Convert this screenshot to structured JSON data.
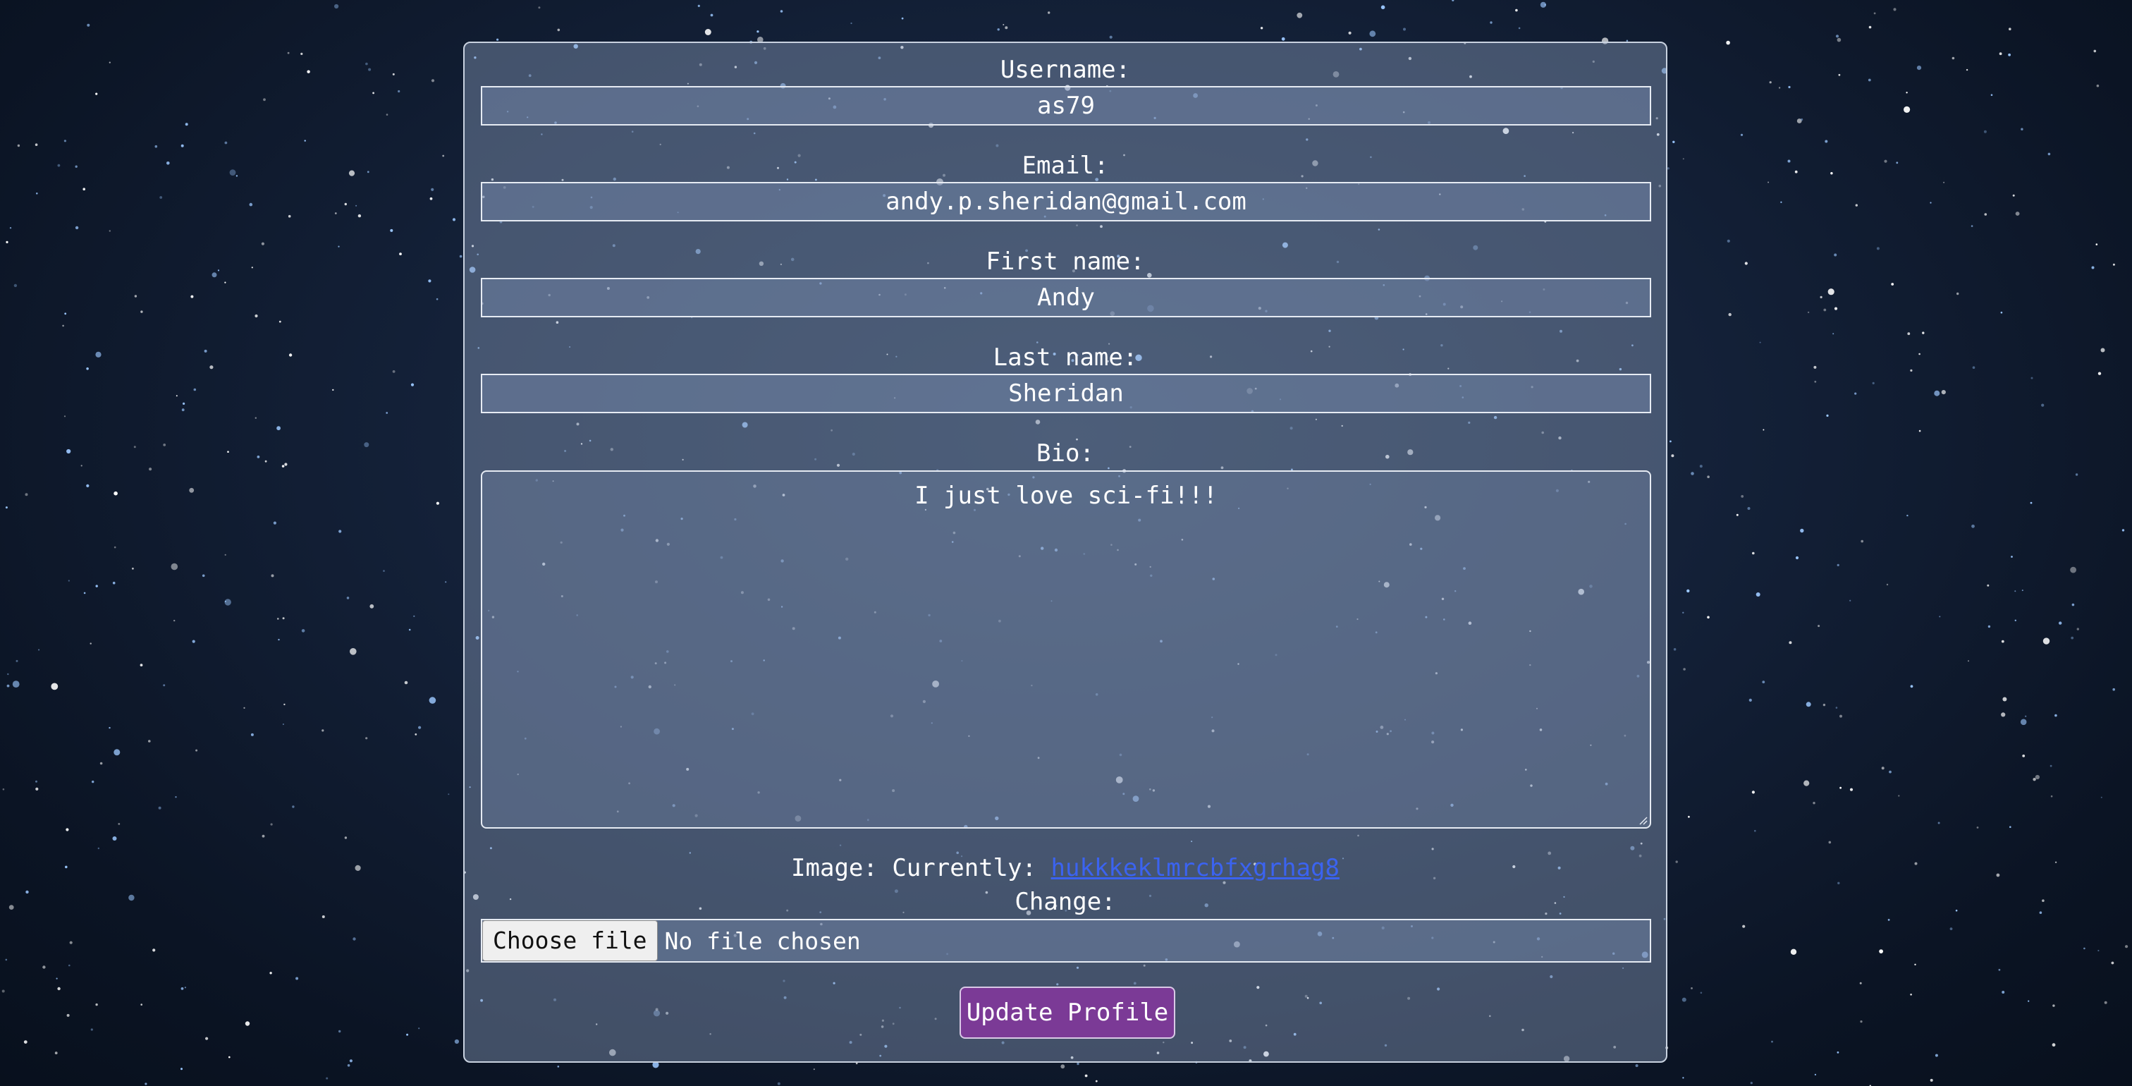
{
  "form": {
    "username": {
      "label": "Username:",
      "value": "as79"
    },
    "email": {
      "label": "Email:",
      "value": "andy.p.sheridan@gmail.com"
    },
    "first_name": {
      "label": "First name:",
      "value": "Andy"
    },
    "last_name": {
      "label": "Last name:",
      "value": "Sheridan"
    },
    "bio": {
      "label": "Bio:",
      "value": "I just love sci-fi!!!"
    },
    "image": {
      "label": "Image:",
      "currently_label": "Currently:",
      "current_file": "hukkkeklmrcbfxgrhag8",
      "change_label": "Change:",
      "choose_button": "Choose file",
      "no_file_text": "No file chosen"
    },
    "submit_label": "Update Profile"
  },
  "colors": {
    "panel_border": "#c9d2e0",
    "link": "#3b63f0",
    "submit_button": "#7b3a96"
  }
}
